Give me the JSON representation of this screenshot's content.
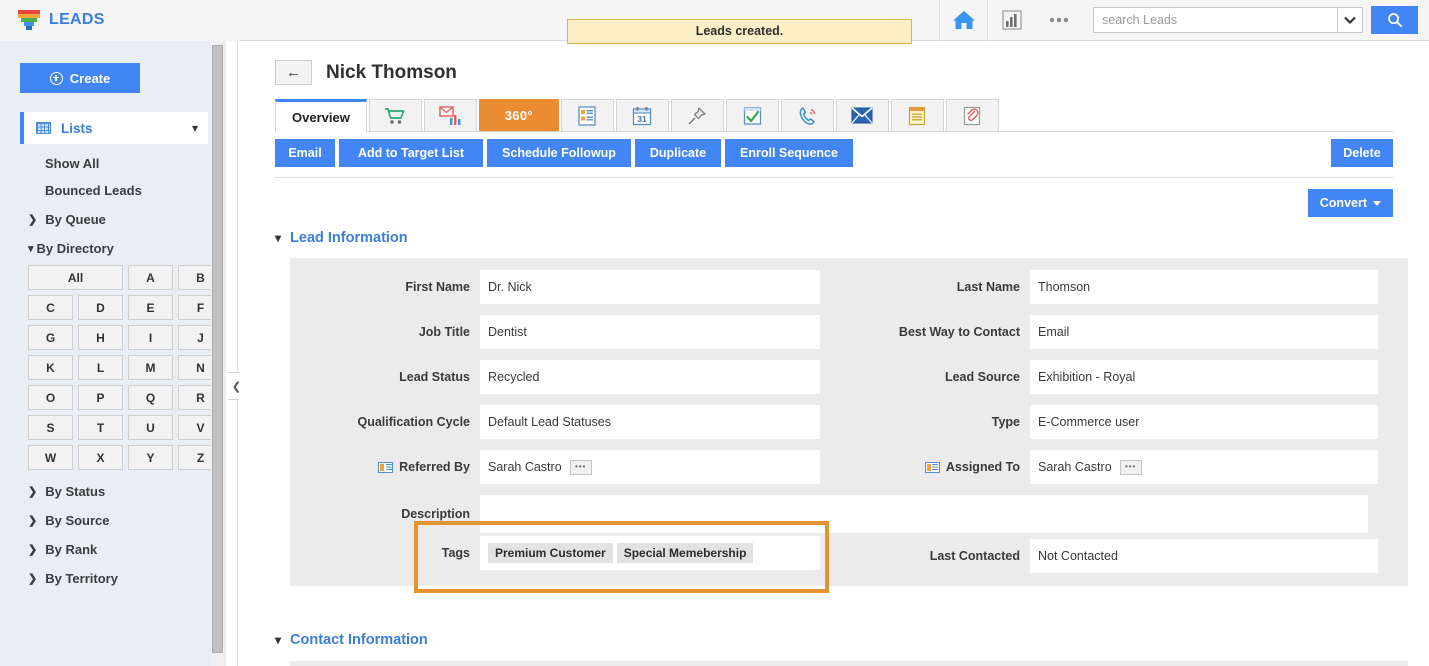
{
  "topbar": {
    "brand": "LEADS",
    "brand_icon": "funnel-icon",
    "alert": "Leads created.",
    "home_icon": "home-icon",
    "chart_icon": "bar-chart-icon",
    "more_icon": "ellipsis-icon",
    "search_placeholder": "search Leads",
    "search_value": "",
    "search_caret_icon": "chevron-down-icon",
    "search_button_icon": "magnifier-icon",
    "accent_color": "#4285f4"
  },
  "sidebar": {
    "create_label": "Create",
    "lists_label": "Lists",
    "lists_icon": "grid-icon",
    "lists_chevron": "⌄",
    "links": [
      "Show All",
      "Bounced Leads"
    ],
    "groups_top": [
      {
        "label": "By Queue",
        "open": false
      }
    ],
    "directory": {
      "label": "By Directory",
      "open": true
    },
    "alpha": [
      "All",
      "A",
      "B",
      "C",
      "D",
      "E",
      "F",
      "G",
      "H",
      "I",
      "J",
      "K",
      "L",
      "M",
      "N",
      "O",
      "P",
      "Q",
      "R",
      "S",
      "T",
      "U",
      "V",
      "W",
      "X",
      "Y",
      "Z"
    ],
    "groups_bottom": [
      {
        "label": "By Status",
        "open": false
      },
      {
        "label": "By Source",
        "open": false
      },
      {
        "label": "By Rank",
        "open": false
      },
      {
        "label": "By Territory",
        "open": false
      }
    ],
    "collapse_icon": "chevron-left-icon"
  },
  "page": {
    "back_icon": "back-arrow-icon",
    "title": "Nick Thomson"
  },
  "tabs": [
    {
      "label": "Overview",
      "type": "text",
      "active": true
    },
    {
      "label": "",
      "icon": "shopping-cart-icon",
      "glyph": "🛒",
      "type": "icon"
    },
    {
      "label": "",
      "icon": "email-analytics-icon",
      "glyph": "📊",
      "type": "icon"
    },
    {
      "label": "360°",
      "icon": "three-sixty-icon",
      "type": "accent"
    },
    {
      "label": "",
      "icon": "list-details-icon",
      "glyph": "📑",
      "type": "icon"
    },
    {
      "label": "",
      "icon": "calendar-icon",
      "glyph": "📅",
      "type": "icon"
    },
    {
      "label": "",
      "icon": "pushpin-icon",
      "glyph": "📌",
      "type": "icon"
    },
    {
      "label": "",
      "icon": "tasks-checkbox-icon",
      "glyph": "☑",
      "type": "icon"
    },
    {
      "label": "",
      "icon": "phone-call-icon",
      "glyph": "📞",
      "type": "icon"
    },
    {
      "label": "",
      "icon": "envelope-icon",
      "glyph": "✉",
      "type": "icon"
    },
    {
      "label": "",
      "icon": "notes-icon",
      "glyph": "🗒",
      "type": "icon"
    },
    {
      "label": "",
      "icon": "attachment-icon",
      "glyph": "📎",
      "type": "icon"
    }
  ],
  "actions": {
    "buttons": [
      "Email",
      "Add to Target List",
      "Schedule Followup",
      "Duplicate",
      "Enroll Sequence"
    ],
    "delete_label": "Delete",
    "convert_label": "Convert"
  },
  "sections": {
    "lead_information": "Lead Information",
    "contact_information": "Contact Information"
  },
  "form": {
    "left": [
      {
        "label": "First Name",
        "value": "Dr. Nick",
        "icon": null
      },
      {
        "label": "Job Title",
        "value": "Dentist",
        "icon": null
      },
      {
        "label": "Lead Status",
        "value": "Recycled",
        "icon": null
      },
      {
        "label": "Qualification Cycle",
        "value": "Default Lead Statuses",
        "icon": null
      },
      {
        "label": "Referred By",
        "value": "Sarah Castro",
        "icon": "id-card-icon",
        "ellipsis": true
      },
      {
        "label": "Description",
        "value": "",
        "icon": null
      },
      {
        "label": "Tags",
        "value": "",
        "icon": null,
        "tags": [
          "Premium Customer",
          "Special Memebership"
        ]
      }
    ],
    "right": [
      {
        "label": "Last Name",
        "value": "Thomson",
        "icon": null
      },
      {
        "label": "Best Way to Contact",
        "value": "Email",
        "icon": null
      },
      {
        "label": "Lead Source",
        "value": "Exhibition - Royal",
        "icon": null
      },
      {
        "label": "Type",
        "value": "E-Commerce user",
        "icon": null
      },
      {
        "label": "Assigned To",
        "value": "Sarah Castro",
        "icon": "id-card-icon",
        "ellipsis": true
      },
      {
        "label": "Last Contacted",
        "value": "Not Contacted",
        "icon": null
      }
    ],
    "ellipsis_glyph": "•••",
    "highlight_color": "#e59330"
  }
}
